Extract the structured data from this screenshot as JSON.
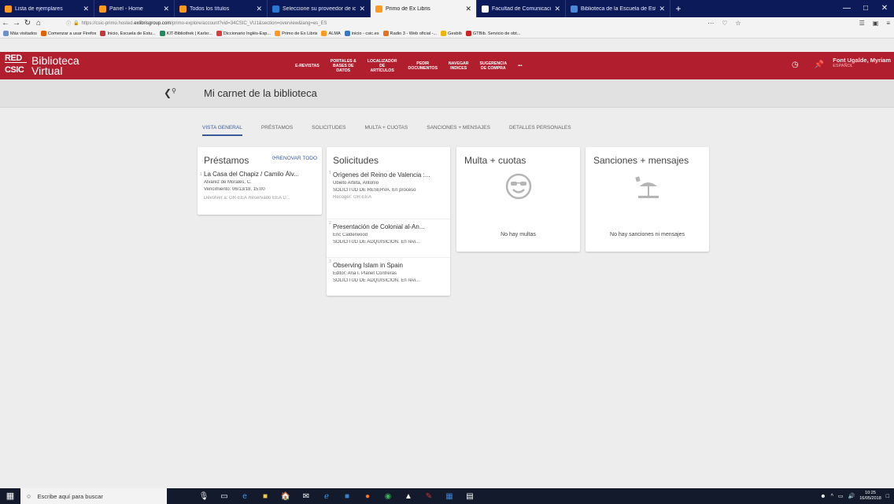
{
  "browser": {
    "tabs": [
      {
        "title": "Lista de ejemplares",
        "color": "#ff9a1f",
        "active": false
      },
      {
        "title": "Panel - Home",
        "color": "#ff9a1f",
        "active": false
      },
      {
        "title": "Todos los títulos",
        "color": "#ff9a1f",
        "active": false
      },
      {
        "title": "Seleccione su proveedor de ide",
        "color": "#2a7ad5",
        "active": false
      },
      {
        "title": "Primo de Ex Libris",
        "color": "#ff9a1f",
        "active": true
      },
      {
        "title": "Facultad de Comunicación y D",
        "color": "#ffffff",
        "active": false
      },
      {
        "title": "Biblioteca de la Escuela de Est",
        "color": "#4a88d9",
        "active": false
      }
    ],
    "url_host": "https://csic-primo.hosted.",
    "url_domain": "exlibrisgroup.com",
    "url_path": "/primo-explore/account?vid=34CSIC_VU1&section=overview&lang=es_ES",
    "bookmarks": [
      {
        "label": "Más visitados",
        "color": "#6f8fca"
      },
      {
        "label": "Comenzar a usar Firefox",
        "color": "#e66000"
      },
      {
        "label": "Inicio, Escuela de Estu...",
        "color": "#cc3333"
      },
      {
        "label": "KIT-Bibliothek | Karlsr...",
        "color": "#1d8a5c"
      },
      {
        "label": "Diccionario Inglés-Esp...",
        "color": "#d93d3d"
      },
      {
        "label": "Primo de Ex Libris",
        "color": "#ff9a1f"
      },
      {
        "label": "ALMA",
        "color": "#ff9a1f"
      },
      {
        "label": "inicio - csic.es",
        "color": "#3877c2"
      },
      {
        "label": "Radio 3 - Web oficial -...",
        "color": "#e86f1e"
      },
      {
        "label": "Gesbib",
        "color": "#f0b400"
      },
      {
        "label": "GTBib. Servicio de obt...",
        "color": "#cc2222"
      }
    ]
  },
  "header": {
    "logo_red": "RED",
    "logo_csic": "CSIC",
    "brand_line1": "Biblioteca",
    "brand_line2": "Virtual",
    "nav": [
      {
        "line1": "E-REVISTAS",
        "line2": "",
        "line3": ""
      },
      {
        "line1": "PORTALES &",
        "line2": "BASES DE",
        "line3": "DATOS"
      },
      {
        "line1": "LOCALIZADOR",
        "line2": "DE",
        "line3": "ARTÍCULOS"
      },
      {
        "line1": "PEDIR",
        "line2": "DOCUMENTOS",
        "line3": ""
      },
      {
        "line1": "NAVEGAR",
        "line2": "INDICES",
        "line3": ""
      },
      {
        "line1": "SUGERENCIA",
        "line2": "DE COMPRA",
        "line3": ""
      },
      {
        "line1": "•••",
        "line2": "",
        "line3": ""
      }
    ],
    "user_name": "Font Ugalde, Myriam",
    "language": "ESPAÑOL",
    "accent": "#b11e2d"
  },
  "page": {
    "title": "Mi carnet de la biblioteca",
    "tabs": [
      "VISTA GENERAL",
      "PRÉSTAMOS",
      "SOLICITUDES",
      "MULTA + CUOTAS",
      "SANCIONES + MENSAJES",
      "DETALLES PERSONALES"
    ]
  },
  "loans": {
    "title": "Préstamos",
    "renew_label": "RENOVAR TODO",
    "items": [
      {
        "index": "1",
        "title": "La Casa del Chapiz / Camilo Álv...",
        "author": "Álvarez de Morales, C.",
        "due": "Vencimiento: 06/13/18, 15:00",
        "return": "Devolver a: GR-EEA Reservado EEA D..."
      }
    ]
  },
  "requests": {
    "title": "Solicitudes",
    "items": [
      {
        "index": "1",
        "title": "Orígenes del Reino de Valencia :...",
        "author": "Ubieto Arteta, Antonio",
        "status": "SOLICITUD DE RESERVA. En proceso",
        "pickup": "Recoger: GR-EEA"
      },
      {
        "index": "2",
        "title": "Presentación de Colonial al-An...",
        "author": "Eric Calderwood",
        "status": "SOLICITUD DE ADQUISICIÓN. En revi...",
        "pickup": ""
      },
      {
        "index": "3",
        "title": "Observing Islam in Spain",
        "author": "Editor: Ana I. Planet Contreras",
        "status": "SOLICITUD DE ADQUISICIÓN. En revi...",
        "pickup": ""
      }
    ]
  },
  "fines": {
    "title": "Multa + cuotas",
    "empty": "No hay multas",
    "icon": "smiley-sunglasses-icon"
  },
  "sanctions": {
    "title": "Sanciones + mensajes",
    "empty": "No hay sanciones ni mensajes",
    "icon": "beach-umbrella-icon"
  },
  "taskbar": {
    "search_placeholder": "Escribe aquí para buscar",
    "time": "10:25",
    "date": "16/05/2018"
  }
}
